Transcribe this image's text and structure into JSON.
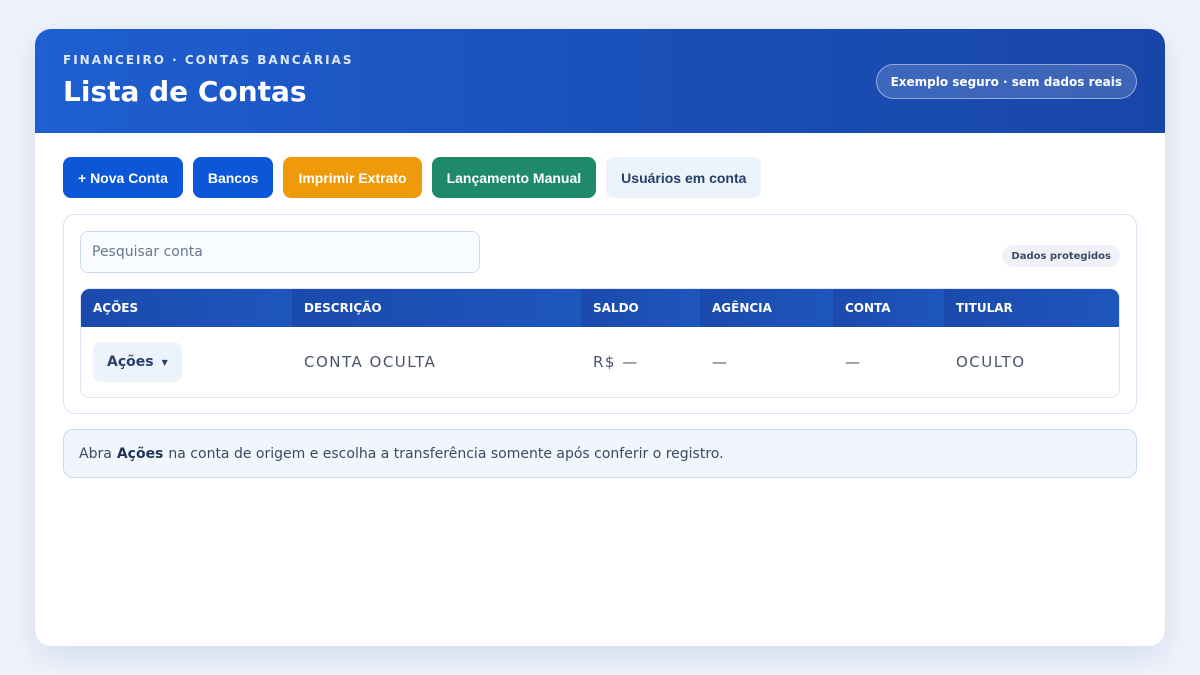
{
  "header": {
    "kicker": "FINANCEIRO · CONTAS BANCÁRIAS",
    "title": "Lista de Contas",
    "badge": "Exemplo seguro · sem dados reais"
  },
  "toolbar": {
    "new_account": "+ Nova Conta",
    "banks": "Bancos",
    "print_statement": "Imprimir Extrato",
    "manual_entry": "Lançamento Manual",
    "account_users": "Usuários em conta"
  },
  "search": {
    "placeholder": "Pesquisar conta",
    "value": ""
  },
  "protected_badge": "Dados protegidos",
  "table": {
    "columns": [
      "AÇÕES",
      "DESCRIÇÃO",
      "SALDO",
      "AGÊNCIA",
      "CONTA",
      "TITULAR"
    ],
    "rows": [
      {
        "actions_label": "Ações",
        "description": "CONTA OCULTA",
        "balance": "R$ —",
        "agency": "—",
        "account": "—",
        "holder": "OCULTO"
      }
    ]
  },
  "note": {
    "prefix": "Abra",
    "bold": "Ações",
    "suffix": "na conta de origem e escolha a transferência somente após conferir o registro."
  },
  "colors": {
    "header_blue": "#1f5fd0",
    "primary_blue": "#0b57d8",
    "orange": "#ee9a0b",
    "green": "#1f8a6b"
  }
}
